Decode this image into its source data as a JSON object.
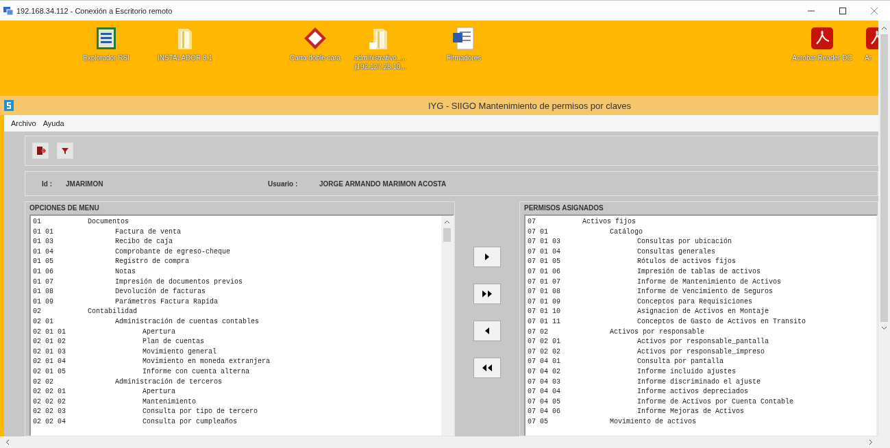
{
  "window": {
    "title": "192.168.34.112 - Conexión a Escritorio remoto"
  },
  "desktop_icons": [
    {
      "kind": "list-doc",
      "label": "Explorador RSI"
    },
    {
      "kind": "folder",
      "label": "INSTALADOR 8.1"
    },
    {
      "kind": "diamond",
      "label": "Carta doble cara"
    },
    {
      "kind": "shortcut-folder",
      "label": "administrativo_... (192.127.28.10..."
    },
    {
      "kind": "word",
      "label": "Firmadores"
    },
    {
      "kind": "acrobat",
      "label": "Acrobat Reader DC"
    },
    {
      "kind": "acrobat",
      "label": "Ar"
    }
  ],
  "app": {
    "title": "IYG - SIIGO Mantenimiento de permisos por claves",
    "menu": [
      "Archivo",
      "Ayuda"
    ],
    "toolbar": [
      {
        "kind": "exit"
      },
      {
        "kind": "filter"
      }
    ],
    "id_label": "Id :",
    "id": "JMARIMON",
    "user_label": "Usuario :",
    "user": "JORGE ARMANDO MARIMON ACOSTA"
  },
  "menu_options": {
    "title": "OPCIONES DE MENU",
    "items": [
      {
        "code": "01",
        "label": "Documentos",
        "children": [
          {
            "code": "01 01",
            "label": "Factura de venta"
          },
          {
            "code": "01 03",
            "label": "Recibo de caja"
          },
          {
            "code": "01 04",
            "label": "Comprobante de egreso-cheque"
          },
          {
            "code": "01 05",
            "label": "Registro de compra"
          },
          {
            "code": "01 06",
            "label": "Notas"
          },
          {
            "code": "01 07",
            "label": "Impresión de documentos previos"
          },
          {
            "code": "01 08",
            "label": "Devolución de facturas"
          },
          {
            "code": "01 09",
            "label": "Parámetros Factura Rapida"
          }
        ]
      },
      {
        "code": "02",
        "label": "Contabilidad",
        "children": [
          {
            "code": "02 01",
            "label": "Administración de cuentas contables",
            "children": [
              {
                "code": "02 01 01",
                "label": "Apertura"
              },
              {
                "code": "02 01 02",
                "label": "Plan de cuentas"
              },
              {
                "code": "02 01 03",
                "label": "Movimiento general"
              },
              {
                "code": "02 01 04",
                "label": "Movimiento en moneda extranjera"
              },
              {
                "code": "02 01 05",
                "label": "Informe con cuenta alterna"
              }
            ]
          },
          {
            "code": "02 02",
            "label": "Administración de terceros",
            "children": [
              {
                "code": "02 02 01",
                "label": "Apertura"
              },
              {
                "code": "02 02 02",
                "label": "Mantenimiento"
              },
              {
                "code": "02 02 03",
                "label": "Consulta por tipo de tercero"
              },
              {
                "code": "02 02 04",
                "label": "Consulta por cumpleaños"
              }
            ]
          }
        ]
      }
    ]
  },
  "transfer_buttons": [
    {
      "kind": "add-one"
    },
    {
      "kind": "add-all"
    },
    {
      "kind": "remove-one"
    },
    {
      "kind": "remove-all"
    }
  ],
  "assigned": {
    "title": "PERMISOS ASIGNADOS",
    "items": [
      {
        "code": "07",
        "label": "Activos fijos",
        "children": [
          {
            "code": "07 01",
            "label": "Catálogo",
            "children": [
              {
                "code": "07 01 03",
                "label": "Consultas por ubicación"
              },
              {
                "code": "07 01 04",
                "label": "Consultas generales"
              },
              {
                "code": "07 01 05",
                "label": "Rótulos de activos fijos"
              },
              {
                "code": "07 01 06",
                "label": "Impresión de tablas de activos"
              },
              {
                "code": "07 01 07",
                "label": "Informe de Mantenimiento de Activos"
              },
              {
                "code": "07 01 08",
                "label": "Informe de Vencimiento de Seguros"
              },
              {
                "code": "07 01 09",
                "label": "Conceptos para Requisiciones"
              },
              {
                "code": "07 01 10",
                "label": "Asignacion de Activos en Montaje"
              },
              {
                "code": "07 01 11",
                "label": "Conceptos de Gasto de Activos en Transito"
              }
            ]
          },
          {
            "code": "07 02",
            "label": "Activos por responsable",
            "children": [
              {
                "code": "07 02 01",
                "label": "Activos por responsable_pantalla"
              },
              {
                "code": "07 02 02",
                "label": "Activos por responsable_impreso"
              },
              {
                "code": "07 04 01",
                "label": "Consulta por pantalla"
              },
              {
                "code": "07 04 02",
                "label": "Informe incluido ajustes"
              },
              {
                "code": "07 04 03",
                "label": "Informe discriminado el ajuste"
              },
              {
                "code": "07 04 04",
                "label": "Informe activos depreciados"
              },
              {
                "code": "07 04 05",
                "label": "Informe de Activos por Cuenta Contable"
              },
              {
                "code": "07 04 06",
                "label": "Informe Mejoras de Activos"
              }
            ]
          },
          {
            "code": "07 05",
            "label": "Movimiento de activos"
          }
        ]
      }
    ]
  }
}
